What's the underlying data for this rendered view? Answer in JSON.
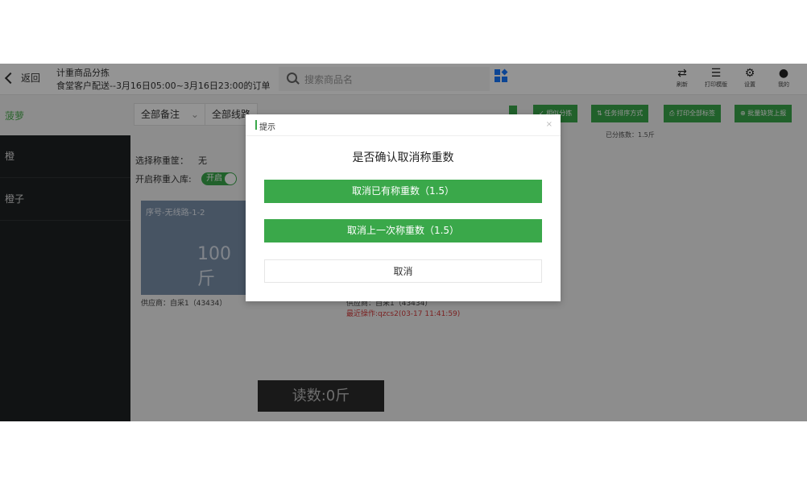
{
  "header": {
    "back_label": "返回",
    "title_line1": "计重商品分拣",
    "title_line2": "食堂客户配送--3月16日05:00~3月16日23:00的订单",
    "search_placeholder": "搜索商品名",
    "tools": [
      {
        "icon": "refresh-icon",
        "glyph": "⇄",
        "label": "刷新"
      },
      {
        "icon": "print-template-icon",
        "glyph": "☰",
        "label": "打印模版"
      },
      {
        "icon": "gear-icon",
        "glyph": "⚙",
        "label": "设置"
      },
      {
        "icon": "user-icon",
        "glyph": "●",
        "label": "我的"
      }
    ]
  },
  "subbar": {
    "category": "菠萝",
    "remark_filter": "全部备注",
    "route_filter": "全部线路",
    "buttons": [
      "✓ 相似分拣",
      "⇅ 任务排序方式",
      "⎙ 打印全部标签",
      "⊕ 批量缺货上报"
    ],
    "sorted_count": "已分拣数：1.5斤"
  },
  "sidebar": {
    "items": [
      "橙",
      "橙子"
    ]
  },
  "main": {
    "scale_label": "选择称重筐：",
    "scale_value": "无",
    "storage_label": "开启称重入库:",
    "toggle_label": "开启",
    "card_seq": "序号-无线路-1-2",
    "card_weight": "100斤",
    "supplier": "供应商：自采1（43434）",
    "supplier2": "供应商：自采1（43434）",
    "recent_op": "最近操作:qzcs2(03-17 11:41:59)",
    "reading": "读数:0斤"
  },
  "modal": {
    "title": "提示",
    "close": "×",
    "question": "是否确认取消称重数",
    "btn_cancel_all": "取消已有称重数（1.5）",
    "btn_cancel_last": "取消上一次称重数（1.5）",
    "btn_cancel": "取消"
  },
  "colors": {
    "accent": "#3aa84a",
    "sidebar_bg": "#1e2123",
    "card_bg": "#7b91ab",
    "warning_text": "#d43b3b"
  }
}
